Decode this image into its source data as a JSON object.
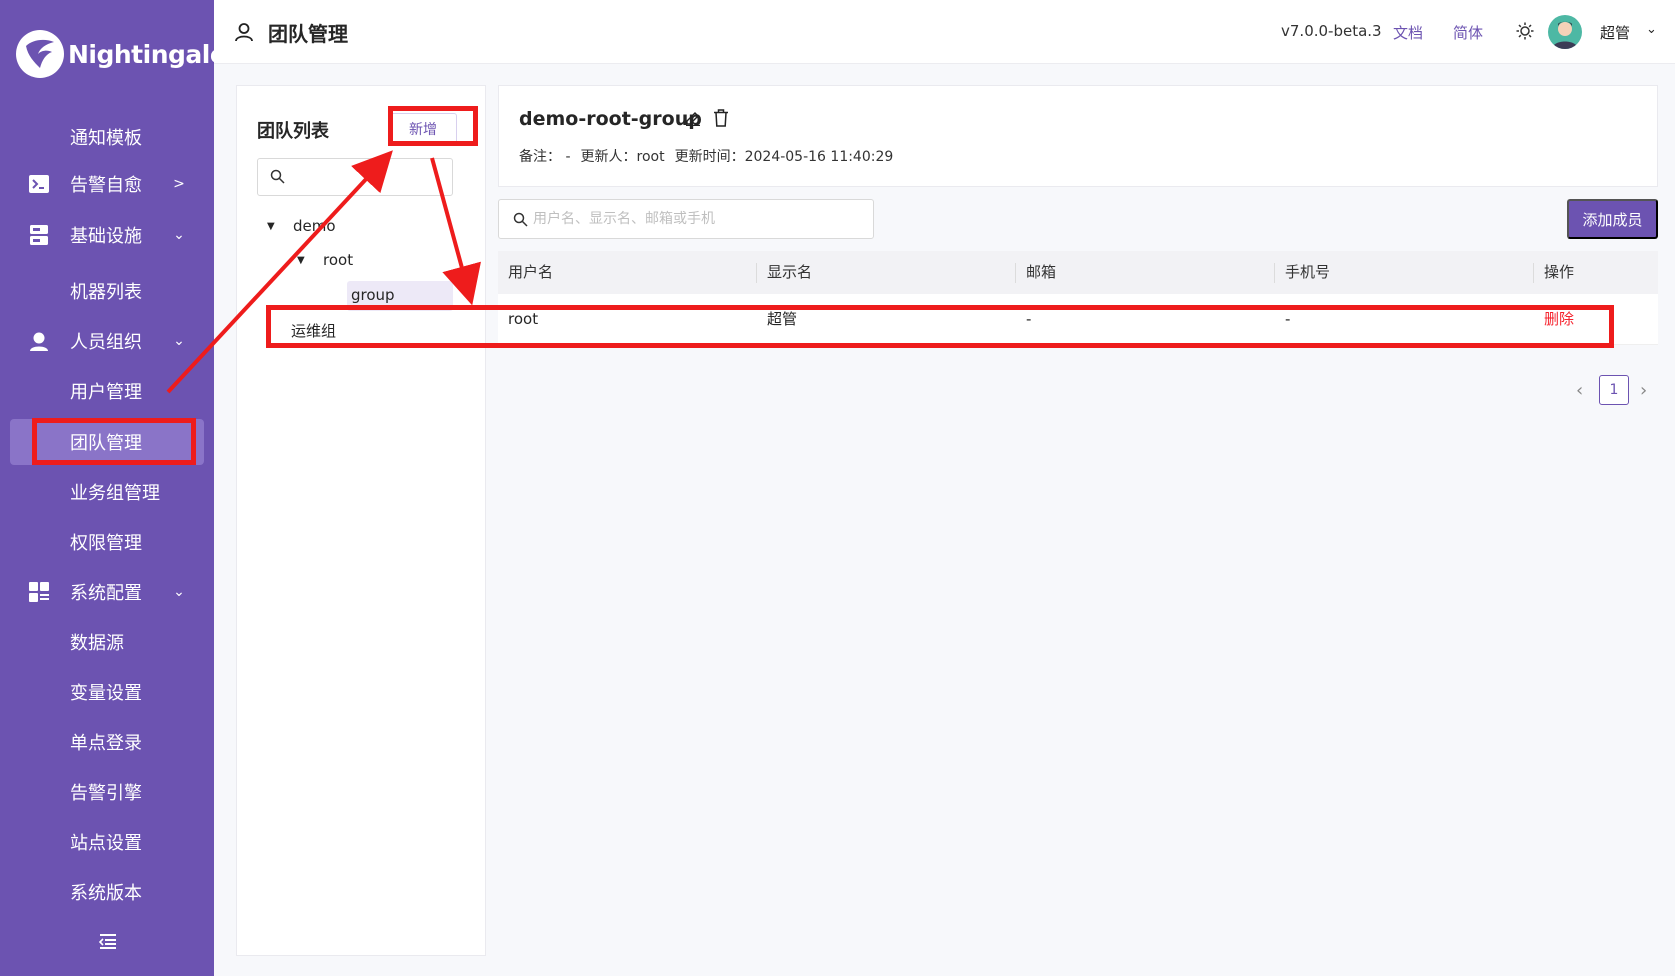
{
  "app": {
    "brand": "Nightingale",
    "brand_color": "#6c53b1"
  },
  "header": {
    "title": "团队管理",
    "version": "v7.0.0-beta.3",
    "docs_link": "文档",
    "lang_link": "简体",
    "user_name": "超管"
  },
  "sidebar": {
    "items": [
      {
        "label": "通知模板"
      },
      {
        "label": "告警自愈",
        "icon": "terminal-icon"
      },
      {
        "label": "基础设施",
        "icon": "server-icon"
      },
      {
        "label": "机器列表"
      },
      {
        "label": "人员组织",
        "icon": "user-icon"
      },
      {
        "label": "用户管理"
      },
      {
        "label": "团队管理",
        "active": true
      },
      {
        "label": "业务组管理"
      },
      {
        "label": "权限管理"
      },
      {
        "label": "系统配置",
        "icon": "grid-icon"
      },
      {
        "label": "数据源"
      },
      {
        "label": "变量设置"
      },
      {
        "label": "单点登录"
      },
      {
        "label": "告警引擎"
      },
      {
        "label": "站点设置"
      },
      {
        "label": "系统版本"
      }
    ]
  },
  "team_panel": {
    "title": "团队列表",
    "add_label": "新增",
    "tree": {
      "root_label": "demo",
      "child_label": "root",
      "leaf_label": "group",
      "sibling_label": "运维组"
    }
  },
  "detail": {
    "group_name": "demo-root-group",
    "note_label": "备注：",
    "note_value": "-",
    "updater_label": "更新人：",
    "updater_value": "root",
    "updated_label": "更新时间：",
    "updated_value": "2024-05-16 11:40:29"
  },
  "members": {
    "search_placeholder": "用户名、显示名、邮箱或手机",
    "add_label": "添加成员",
    "columns": [
      "用户名",
      "显示名",
      "邮箱",
      "手机号",
      "操作"
    ],
    "rows": [
      {
        "username": "root",
        "display_name": "超管",
        "email": "-",
        "phone": "-",
        "action": "删除"
      }
    ],
    "page": "1"
  }
}
